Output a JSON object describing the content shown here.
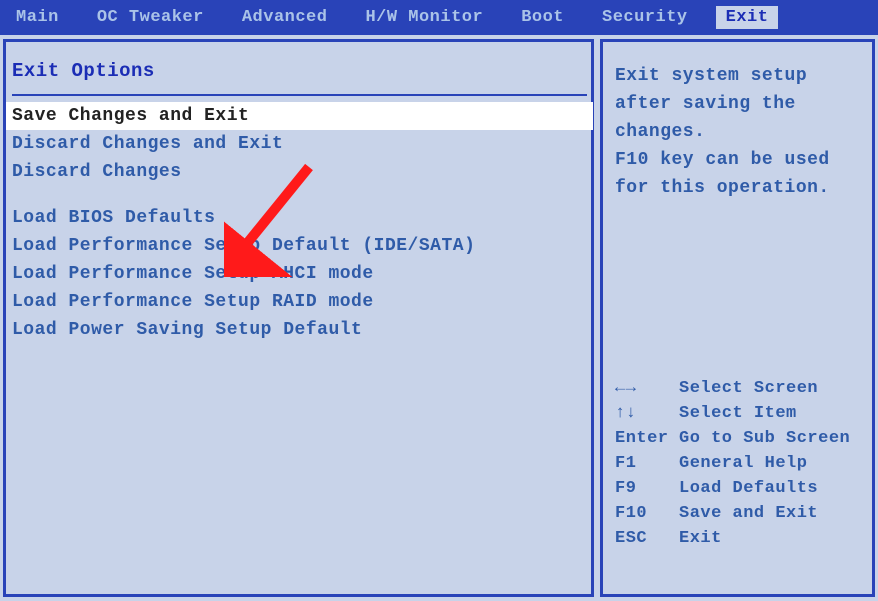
{
  "menubar": {
    "items": [
      {
        "label": "Main"
      },
      {
        "label": "OC Tweaker"
      },
      {
        "label": "Advanced"
      },
      {
        "label": "H/W Monitor"
      },
      {
        "label": "Boot"
      },
      {
        "label": "Security"
      },
      {
        "label": "Exit"
      }
    ],
    "active_index": 6
  },
  "left": {
    "title": "Exit Options",
    "group1": [
      "Save Changes and Exit",
      "Discard Changes and Exit",
      "Discard Changes"
    ],
    "group2": [
      "Load BIOS Defaults",
      "Load Performance Setup Default (IDE/SATA)",
      "Load Performance Setup AHCI mode",
      "Load Performance Setup RAID mode",
      "Load Power Saving Setup Default"
    ],
    "selected_index": 0
  },
  "right": {
    "help_lines": [
      "Exit system setup",
      "after saving the",
      "changes.",
      "",
      "F10 key can be used",
      "for this operation."
    ],
    "keys": [
      {
        "key": "←→",
        "desc": "Select Screen"
      },
      {
        "key": "↑↓",
        "desc": "Select Item"
      },
      {
        "key": "Enter",
        "desc": "Go to Sub Screen"
      },
      {
        "key": "F1",
        "desc": "General Help"
      },
      {
        "key": "F9",
        "desc": "Load Defaults"
      },
      {
        "key": "F10",
        "desc": "Save and Exit"
      },
      {
        "key": "ESC",
        "desc": "Exit"
      }
    ]
  }
}
